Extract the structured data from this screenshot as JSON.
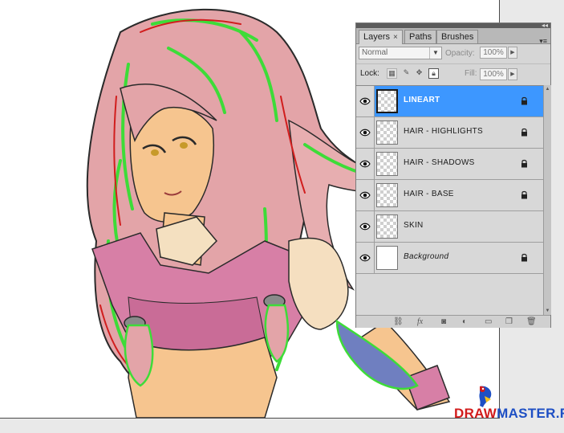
{
  "panel": {
    "tabs": [
      {
        "label": "Layers",
        "close": "×"
      },
      {
        "label": "Paths"
      },
      {
        "label": "Brushes"
      }
    ],
    "menu_icon": "▾≡",
    "blend_mode": "Normal",
    "opacity_label": "Opacity:",
    "opacity_value": "100%",
    "lock_label": "Lock:",
    "fill_label": "Fill:",
    "fill_value": "100%",
    "layers": [
      {
        "name": "LINEART",
        "selected": true,
        "locked": true
      },
      {
        "name": "HAIR - HIGHLIGHTS",
        "selected": false,
        "locked": true
      },
      {
        "name": "HAIR - SHADOWS",
        "selected": false,
        "locked": true
      },
      {
        "name": "HAIR - BASE",
        "selected": false,
        "locked": true
      },
      {
        "name": "SKIN",
        "selected": false,
        "locked": false
      },
      {
        "name": "Background",
        "selected": false,
        "locked": true
      }
    ],
    "bottom_icons": [
      "link-icon",
      "fx-icon",
      "mask-icon",
      "adjustment-icon",
      "folder-icon",
      "new-layer-icon",
      "trash-icon"
    ],
    "fx_label": "fx"
  },
  "watermark": {
    "part1": "DRAW",
    "part2": "MASTER.RU"
  },
  "colors": {
    "selected_row": "#3d97ff",
    "hair_pink": "#e3a4a8",
    "hair_green": "#3ddc38",
    "skin": "#f6c58f",
    "jacket": "#d77fa6"
  }
}
